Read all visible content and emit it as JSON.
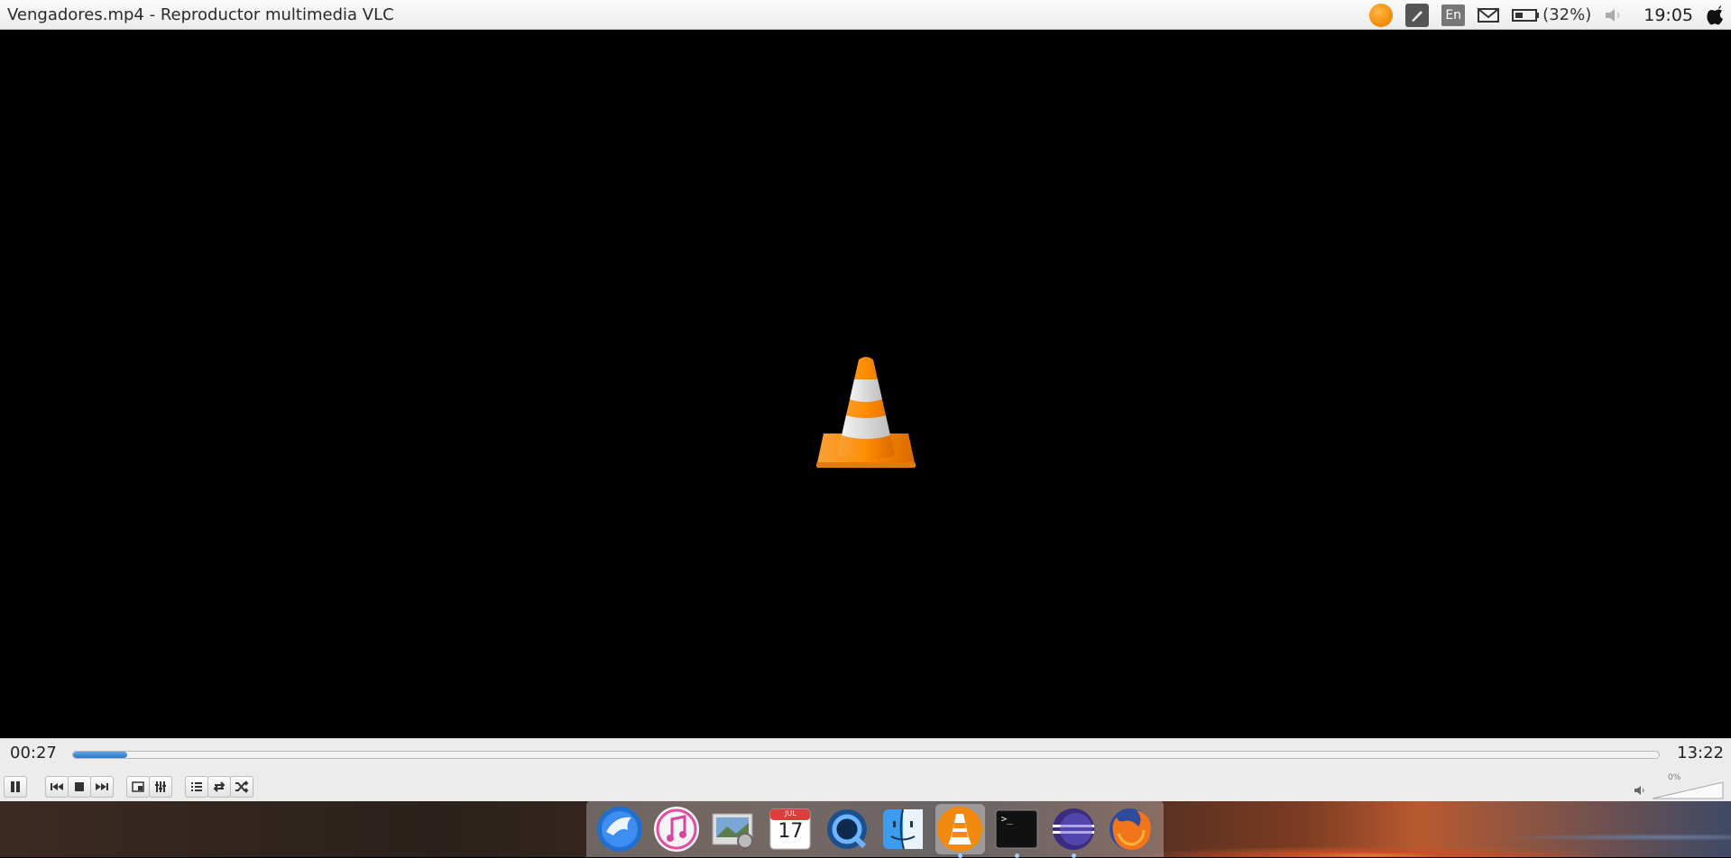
{
  "window": {
    "title": "Vengadores.mp4 - Reproductor multimedia VLC"
  },
  "tray": {
    "icons": [
      "vlc-icon",
      "brush-icon",
      "keyboard-language-indicator",
      "mail-icon",
      "battery-icon",
      "speaker-muted-icon",
      "apple-icon"
    ],
    "language": "En",
    "battery": "(32%)",
    "clock": "19:05"
  },
  "player": {
    "elapsed": "00:27",
    "total": "13:22",
    "progress_fraction": 0.034,
    "volume_label": "0%",
    "buttons": [
      "pause-icon",
      "previous-icon",
      "stop-icon",
      "next-icon",
      "fullscreen-icon",
      "extended-settings-icon",
      "playlist-icon",
      "loop-icon",
      "shuffle-icon"
    ]
  },
  "dock": {
    "apps": [
      "eagle-app",
      "itunes",
      "preview",
      "calendar",
      "quicktime",
      "finder",
      "vlc",
      "terminal",
      "eclipse",
      "firefox"
    ],
    "calendar_month": "JUL",
    "calendar_day": "17",
    "terminal_prompt": ">_",
    "colors": {
      "accent": "#2a78c8",
      "vlc_orange": "#f08a00"
    }
  }
}
